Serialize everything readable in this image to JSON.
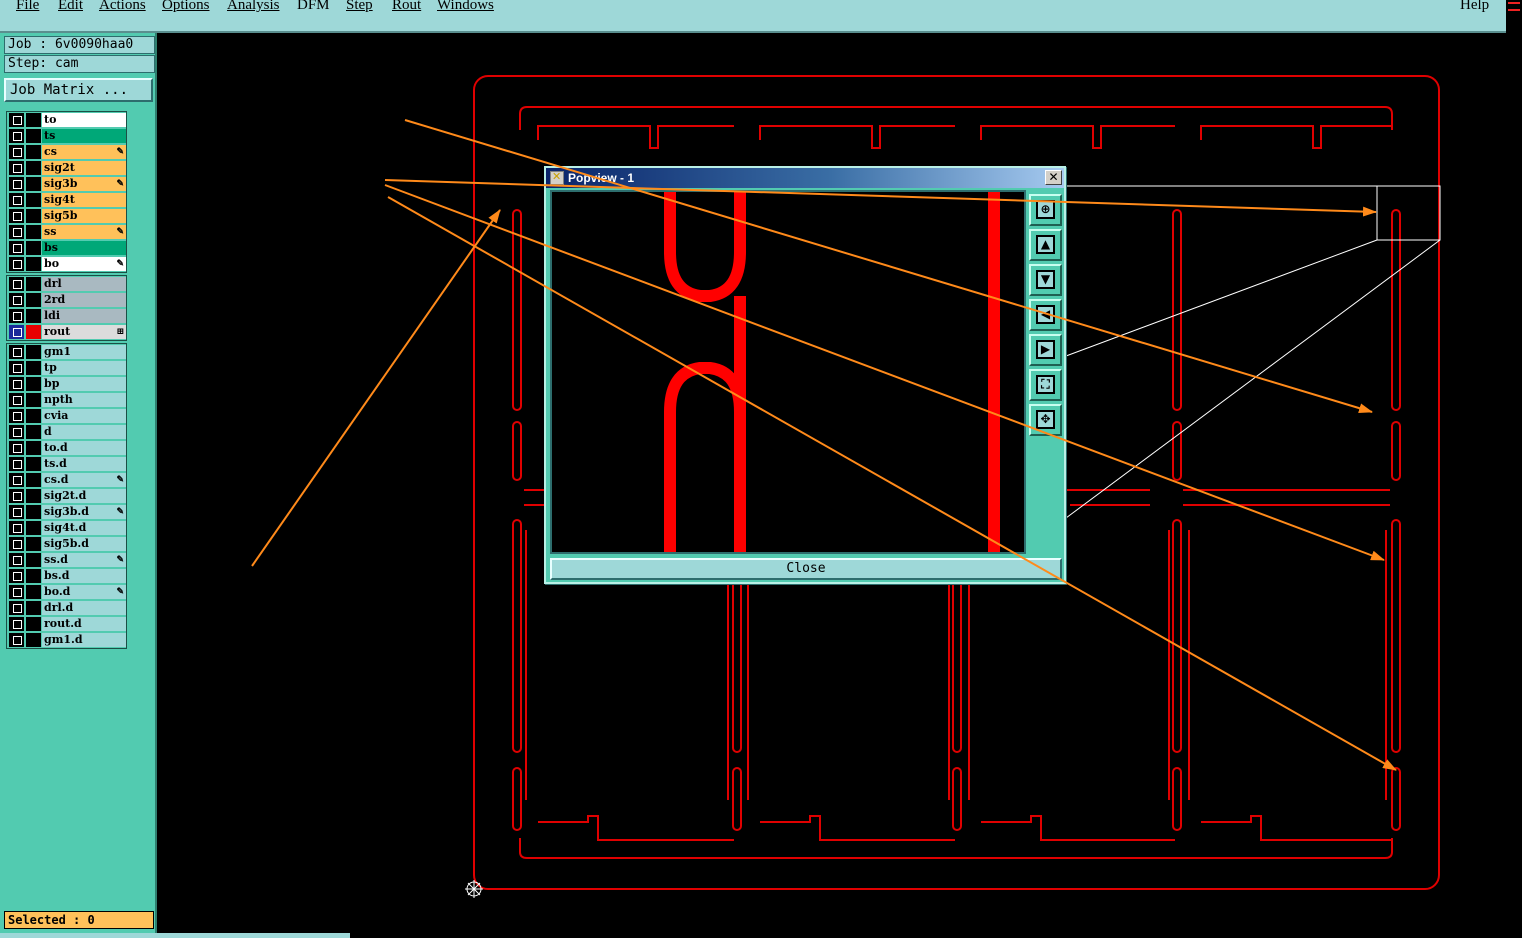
{
  "menu": {
    "items": [
      {
        "label": "File",
        "key": "F"
      },
      {
        "label": "Edit",
        "key": "E"
      },
      {
        "label": "Actions",
        "key": "A"
      },
      {
        "label": "Options",
        "key": "O"
      },
      {
        "label": "Analysis",
        "key": "A"
      },
      {
        "label": "DFM",
        "key": ""
      },
      {
        "label": "Step",
        "key": "S"
      },
      {
        "label": "Rout",
        "key": "R"
      },
      {
        "label": "Windows",
        "key": "W"
      }
    ],
    "help": "Help"
  },
  "panel": {
    "job": "Job : 6v0090haa0",
    "step": "Step: cam",
    "job_matrix_button": "Job Matrix ..."
  },
  "layer_groups": [
    [
      {
        "name": "to",
        "color": "#ffffff",
        "flag": ""
      },
      {
        "name": "ts",
        "color": "#00a878",
        "flag": ""
      },
      {
        "name": "cs",
        "color": "#ffc15a",
        "flag": "✎"
      },
      {
        "name": "sig2t",
        "color": "#ffc15a",
        "flag": ""
      },
      {
        "name": "sig3b",
        "color": "#ffc15a",
        "flag": "✎"
      },
      {
        "name": "sig4t",
        "color": "#ffc15a",
        "flag": ""
      },
      {
        "name": "sig5b",
        "color": "#ffc15a",
        "flag": ""
      },
      {
        "name": "ss",
        "color": "#ffc15a",
        "flag": "✎"
      },
      {
        "name": "bs",
        "color": "#00a878",
        "flag": ""
      },
      {
        "name": "bo",
        "color": "#ffffff",
        "flag": "✎"
      }
    ],
    [
      {
        "name": "drl",
        "color": "#a9b9c1",
        "flag": ""
      },
      {
        "name": "2rd",
        "color": "#a9b9c1",
        "flag": ""
      },
      {
        "name": "ldi",
        "color": "#a9b9c1",
        "flag": ""
      },
      {
        "name": "rout",
        "color": "#dcdcdc",
        "flag": "⊞",
        "active": true
      }
    ],
    [
      {
        "name": "gm1",
        "color": "#9ed8d8",
        "flag": ""
      },
      {
        "name": "tp",
        "color": "#9ed8d8",
        "flag": ""
      },
      {
        "name": "bp",
        "color": "#9ed8d8",
        "flag": ""
      },
      {
        "name": "npth",
        "color": "#9ed8d8",
        "flag": ""
      },
      {
        "name": "cvia",
        "color": "#9ed8d8",
        "flag": ""
      },
      {
        "name": "d",
        "color": "#9ed8d8",
        "flag": ""
      },
      {
        "name": "to.d",
        "color": "#9ed8d8",
        "flag": ""
      },
      {
        "name": "ts.d",
        "color": "#9ed8d8",
        "flag": ""
      },
      {
        "name": "cs.d",
        "color": "#9ed8d8",
        "flag": "✎"
      },
      {
        "name": "sig2t.d",
        "color": "#9ed8d8",
        "flag": ""
      },
      {
        "name": "sig3b.d",
        "color": "#9ed8d8",
        "flag": "✎"
      },
      {
        "name": "sig4t.d",
        "color": "#9ed8d8",
        "flag": ""
      },
      {
        "name": "sig5b.d",
        "color": "#9ed8d8",
        "flag": ""
      },
      {
        "name": "ss.d",
        "color": "#9ed8d8",
        "flag": "✎"
      },
      {
        "name": "bs.d",
        "color": "#9ed8d8",
        "flag": ""
      },
      {
        "name": "bo.d",
        "color": "#9ed8d8",
        "flag": "✎"
      },
      {
        "name": "drl.d",
        "color": "#9ed8d8",
        "flag": ""
      },
      {
        "name": "rout.d",
        "color": "#9ed8d8",
        "flag": ""
      },
      {
        "name": "gm1.d",
        "color": "#9ed8d8",
        "flag": ""
      }
    ]
  ],
  "status": {
    "selected": "Selected : 0"
  },
  "popview": {
    "title": "Popview - 1",
    "close_label": "Close",
    "tools": [
      "zoom-in-icon",
      "pan-up-icon",
      "pan-down-icon",
      "pan-left-icon",
      "pan-right-icon",
      "fit-icon",
      "center-icon"
    ]
  },
  "colors": {
    "rout": "#e00000",
    "annotation": "#ff8a1a",
    "panel": "#52cbb0"
  }
}
